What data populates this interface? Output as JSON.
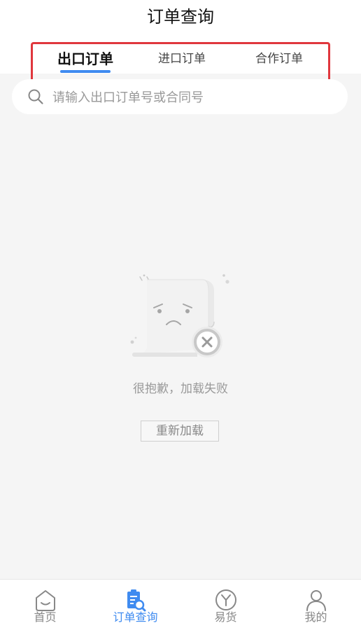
{
  "header": {
    "title": "订单查询"
  },
  "tabs": [
    {
      "label": "出口订单",
      "active": true
    },
    {
      "label": "进口订单",
      "active": false
    },
    {
      "label": "合作订单",
      "active": false
    }
  ],
  "search": {
    "placeholder": "请输入出口订单号或合同号",
    "value": ""
  },
  "empty_state": {
    "message": "很抱歉，加载失败",
    "reload_label": "重新加载",
    "illustration": "sad-document-error"
  },
  "bottom_nav": [
    {
      "label": "首页",
      "icon": "home-icon",
      "active": false
    },
    {
      "label": "订单查询",
      "icon": "order-search-icon",
      "active": true
    },
    {
      "label": "易货",
      "icon": "barter-icon",
      "active": false
    },
    {
      "label": "我的",
      "icon": "profile-icon",
      "active": false
    }
  ],
  "colors": {
    "accent": "#3f8bf0",
    "highlight_border": "#e0373d",
    "background": "#f5f5f5",
    "muted_text": "#999999"
  }
}
